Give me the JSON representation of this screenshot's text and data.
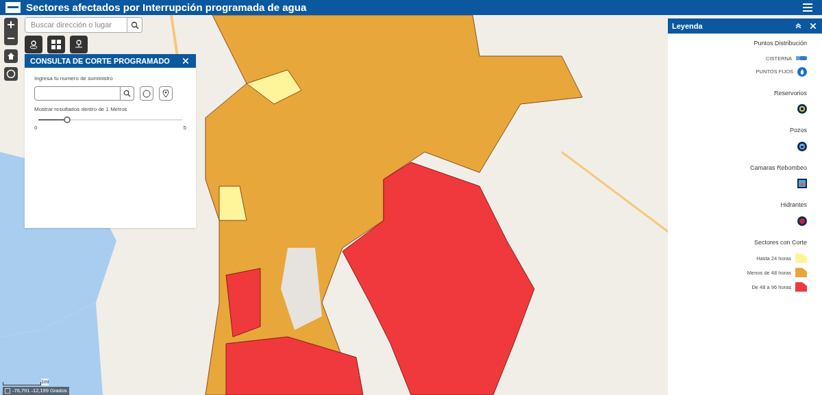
{
  "header": {
    "title": "Sectores afectados por Interrupción programada de agua"
  },
  "search": {
    "placeholder": "Buscar dirección o lugar"
  },
  "query_panel": {
    "title": "CONSULTA DE CORTE PROGRAMADO",
    "field_label": "Ingresa tu numero de suministro",
    "slider_label": "Mostrar resultados dentro de 1 Metros",
    "slider": {
      "level": 0.2,
      "min": "0",
      "max": "5"
    }
  },
  "legend": {
    "title": "Leyenda",
    "sections": [
      {
        "title": "Puntos Distribución",
        "items": [
          {
            "kind": "cistern",
            "label": "CISTERNA"
          },
          {
            "kind": "drop",
            "label": "PUNTOS FIJOS"
          }
        ]
      },
      {
        "title": "Reservorios",
        "items": [
          {
            "kind": "reservoir"
          }
        ]
      },
      {
        "title": "Pozos",
        "items": [
          {
            "kind": "well"
          }
        ]
      },
      {
        "title": "Camaras Rebombeo",
        "items": [
          {
            "kind": "pump"
          }
        ]
      },
      {
        "title": "Hidrantes",
        "items": [
          {
            "kind": "hydrant"
          }
        ]
      },
      {
        "title": "Sectores con Corte",
        "items": [
          {
            "kind": "area",
            "label": "Hasta 24 horas",
            "color": "#fef59b"
          },
          {
            "kind": "area",
            "label": "Menos de 48 horas",
            "color": "#e8a73a"
          },
          {
            "kind": "area",
            "label": "De 48 a 96 horas",
            "color": "#f0393c"
          }
        ]
      }
    ]
  },
  "scale": {
    "label": "1mi"
  },
  "coordinates": {
    "text": "-76,791 -12,199 Grados"
  }
}
